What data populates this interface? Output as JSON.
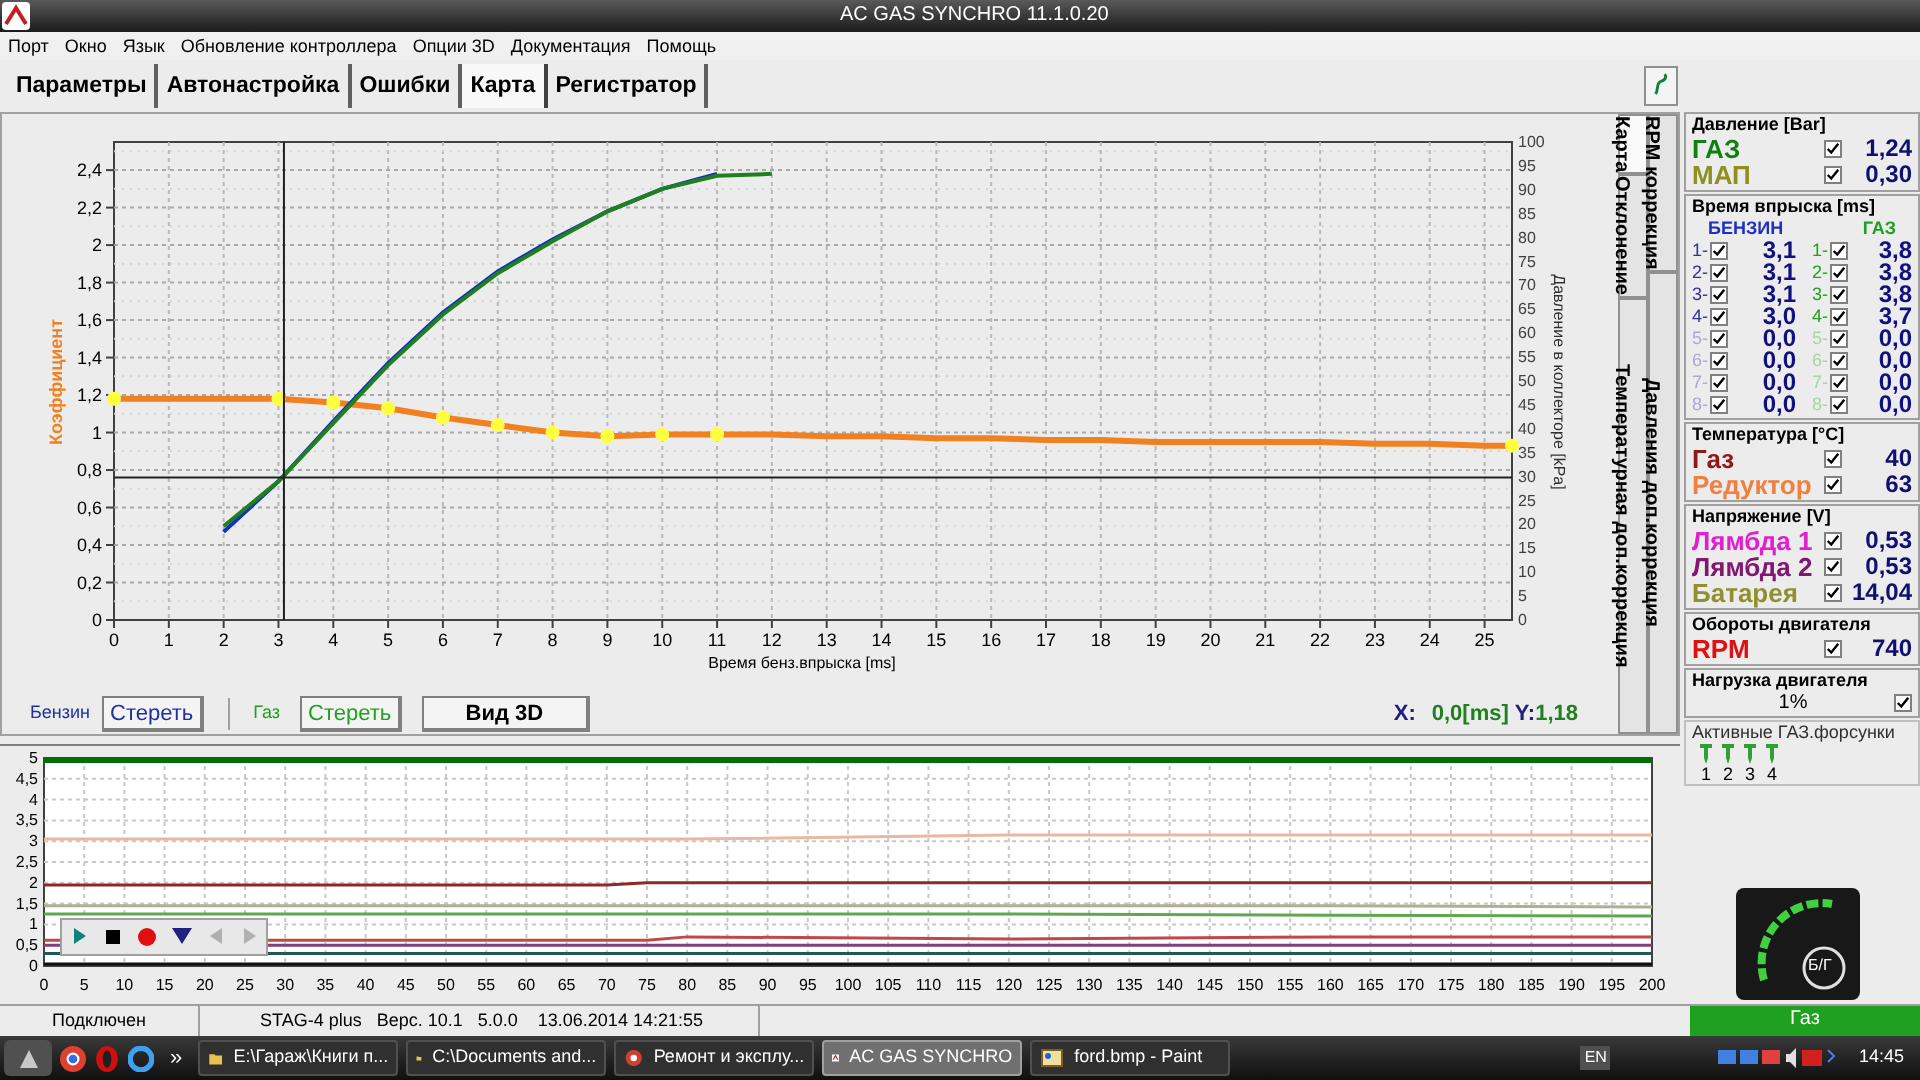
{
  "window": {
    "title": "AC GAS SYNCHRO  11.1.0.20"
  },
  "menu": [
    "Порт",
    "Окно",
    "Язык",
    "Обновление контроллера",
    "Опции 3D",
    "Документация",
    "Помощь"
  ],
  "tabs": [
    {
      "label": "Параметры",
      "selected": false
    },
    {
      "label": "Автонастройка",
      "selected": false
    },
    {
      "label": "Ошибки",
      "selected": false
    },
    {
      "label": "Карта",
      "selected": true
    },
    {
      "label": "Регистратор",
      "selected": false
    }
  ],
  "map_chart": {
    "right_axis": {
      "label": "Давление в коллекторе [kPa]",
      "ticks": [
        "100",
        "95",
        "90",
        "85",
        "80",
        "75",
        "70",
        "65",
        "60",
        "55",
        "50",
        "45",
        "40",
        "35",
        "30",
        "25",
        "20",
        "15",
        "10",
        "5",
        "0"
      ]
    },
    "chart_data": {
      "type": "line",
      "xlabel": "Время бенз.впрыска [ms]",
      "ylabel": "Коэффициент",
      "grid": true,
      "x": [
        0,
        1,
        2,
        3,
        4,
        5,
        6,
        7,
        8,
        9,
        10,
        11,
        12,
        13,
        14,
        15,
        16,
        17,
        18,
        19,
        20,
        21,
        22,
        23,
        24,
        25,
        25.5
      ],
      "series": [
        {
          "color": "#f08020",
          "values": [
            1.18,
            1.18,
            1.18,
            1.18,
            1.16,
            1.13,
            1.08,
            1.04,
            1.0,
            0.98,
            0.99,
            0.99,
            0.99,
            0.98,
            0.98,
            0.97,
            0.97,
            0.96,
            0.96,
            0.95,
            0.95,
            0.95,
            0.95,
            0.94,
            0.94,
            0.93,
            0.93
          ]
        },
        {
          "type": "scatter",
          "color": "#ffff40",
          "values": [
            1.18,
            null,
            null,
            1.18,
            1.16,
            1.13,
            1.08,
            1.04,
            1.0,
            0.98,
            0.99,
            0.99,
            null,
            null,
            null,
            null,
            null,
            null,
            null,
            null,
            null,
            null,
            null,
            null,
            null,
            null,
            0.93
          ]
        },
        {
          "color": "#1030c0",
          "values": [
            null,
            null,
            0.47,
            0.74,
            1.06,
            1.37,
            1.64,
            1.86,
            2.03,
            2.18,
            2.3,
            2.38,
            null,
            null,
            null,
            null,
            null,
            null,
            null,
            null,
            null,
            null,
            null,
            null,
            null,
            null,
            null
          ]
        },
        {
          "color": "#208020",
          "values": [
            null,
            null,
            0.5,
            0.74,
            1.05,
            1.36,
            1.63,
            1.85,
            2.02,
            2.18,
            2.3,
            2.37,
            2.38,
            null,
            null,
            null,
            null,
            null,
            null,
            null,
            null,
            null,
            null,
            null,
            null,
            null,
            null
          ]
        }
      ],
      "xlim": [
        0,
        25.5
      ],
      "ylim": [
        0,
        2.55
      ],
      "xticks": [
        0,
        1,
        2,
        3,
        4,
        5,
        6,
        7,
        8,
        9,
        10,
        11,
        12,
        13,
        14,
        15,
        16,
        17,
        18,
        19,
        20,
        21,
        22,
        23,
        24,
        25
      ],
      "yticks": [
        {
          "value": 0,
          "label": "0"
        },
        {
          "value": 0.2,
          "label": "0,2"
        },
        {
          "value": 0.4,
          "label": "0,4"
        },
        {
          "value": 0.6,
          "label": "0,6"
        },
        {
          "value": 0.8,
          "label": "0,8"
        },
        {
          "value": 1,
          "label": "1"
        },
        {
          "value": 1.2,
          "label": "1,2"
        },
        {
          "value": 1.4,
          "label": "1,4"
        },
        {
          "value": 1.6,
          "label": "1,6"
        },
        {
          "value": 1.8,
          "label": "1,8"
        },
        {
          "value": 2,
          "label": "2"
        },
        {
          "value": 2.2,
          "label": "2,2"
        },
        {
          "value": 2.4,
          "label": "2,4"
        }
      ],
      "ref_lines": [
        {
          "axis": "x",
          "value": 3.1
        },
        {
          "axis": "y",
          "value": 0.76
        }
      ]
    }
  },
  "side_tabs": [
    {
      "tabs": [
        {
          "label": "Карта",
          "selected": true
        },
        {
          "label": "Отклонение",
          "selected": false
        },
        {
          "label": "Температурная доп.коррекция",
          "selected": false
        }
      ]
    },
    {
      "tabs": [
        {
          "label": "RPM коррекция",
          "selected": false
        },
        {
          "label": "Давления доп.коррекция",
          "selected": false
        }
      ]
    }
  ],
  "controls": {
    "petrol_label": "Бензин",
    "petrol_button": "Стереть",
    "gas_label": "Газ",
    "gas_button": "Стереть",
    "view_button": "Вид 3D",
    "x_label": "X:",
    "x_value": "0,0[ms]",
    "y_label": "Y:",
    "y_value": "1,18"
  },
  "strip_chart": {
    "chart_data": {
      "type": "line",
      "grid": true,
      "x": [
        0,
        40,
        70,
        75,
        80,
        120,
        160,
        200
      ],
      "series": [
        {
          "color": "#007000",
          "values": [
            4.95,
            4.95,
            4.95,
            4.95,
            4.95,
            4.95,
            4.95,
            4.95
          ]
        },
        {
          "color": "#e8b8a0",
          "values": [
            3.05,
            3.05,
            3.05,
            3.05,
            3.05,
            3.15,
            3.15,
            3.15
          ]
        },
        {
          "color": "#902828",
          "values": [
            1.95,
            1.95,
            1.95,
            2.0,
            2.0,
            2.0,
            2.0,
            2.0
          ]
        },
        {
          "color": "#b0b090",
          "values": [
            1.45,
            1.45,
            1.45,
            1.45,
            1.45,
            1.45,
            1.45,
            1.42
          ]
        },
        {
          "color": "#60a850",
          "values": [
            1.25,
            1.25,
            1.25,
            1.25,
            1.25,
            1.25,
            1.22,
            1.2
          ]
        },
        {
          "color": "#c04848",
          "values": [
            0.62,
            0.62,
            0.62,
            0.62,
            0.7,
            0.65,
            0.7,
            0.7
          ]
        },
        {
          "color": "#804080",
          "values": [
            0.5,
            0.5,
            0.5,
            0.5,
            0.5,
            0.5,
            0.5,
            0.5
          ]
        },
        {
          "color": "#205858",
          "values": [
            0.3,
            0.3,
            0.3,
            0.3,
            0.3,
            0.3,
            0.3,
            0.3
          ]
        },
        {
          "color": "#101010",
          "values": [
            0.05,
            0.05,
            0.05,
            0.05,
            0.05,
            0.05,
            0.05,
            0.05
          ]
        }
      ],
      "xlim": [
        0,
        200
      ],
      "ylim": [
        0,
        5
      ],
      "xticks": [
        0,
        5,
        10,
        15,
        20,
        25,
        30,
        35,
        40,
        45,
        50,
        55,
        60,
        65,
        70,
        75,
        80,
        85,
        90,
        95,
        100,
        105,
        110,
        115,
        120,
        125,
        130,
        135,
        140,
        145,
        150,
        155,
        160,
        165,
        170,
        175,
        180,
        185,
        190,
        195,
        200
      ],
      "yticks": [
        {
          "value": 0,
          "label": "0"
        },
        {
          "value": 0.5,
          "label": "0,5"
        },
        {
          "value": 1,
          "label": "1"
        },
        {
          "value": 1.5,
          "label": "1,5"
        },
        {
          "value": 2,
          "label": "2"
        },
        {
          "value": 2.5,
          "label": "2,5"
        },
        {
          "value": 3,
          "label": "3"
        },
        {
          "value": 3.5,
          "label": "3,5"
        },
        {
          "value": 4,
          "label": "4"
        },
        {
          "value": 4.5,
          "label": "4,5"
        },
        {
          "value": 5,
          "label": "5"
        }
      ]
    }
  },
  "right_panel": {
    "pressure": {
      "title": "Давление [Bar]",
      "items": [
        {
          "label": "ГАЗ",
          "color": "#108010",
          "checked": true,
          "value": "1,24"
        },
        {
          "label": "МАП",
          "color": "#909020",
          "checked": true,
          "value": "0,30"
        }
      ]
    },
    "injection": {
      "title": "Время впрыска [ms]",
      "petrol_header": "БЕНЗИН",
      "gas_header": "ГАЗ",
      "rows": [
        {
          "petrol_index": "1-",
          "petrol_checked": true,
          "petrol_value": "3,1",
          "gas_index": "1-",
          "gas_checked": true,
          "gas_value": "3,8",
          "active": true
        },
        {
          "petrol_index": "2-",
          "petrol_checked": true,
          "petrol_value": "3,1",
          "gas_index": "2-",
          "gas_checked": true,
          "gas_value": "3,8",
          "active": true
        },
        {
          "petrol_index": "3-",
          "petrol_checked": true,
          "petrol_value": "3,1",
          "gas_index": "3-",
          "gas_checked": true,
          "gas_value": "3,8",
          "active": true
        },
        {
          "petrol_index": "4-",
          "petrol_checked": true,
          "petrol_value": "3,0",
          "gas_index": "4-",
          "gas_checked": true,
          "gas_value": "3,7",
          "active": true
        },
        {
          "petrol_index": "5-",
          "petrol_checked": true,
          "petrol_value": "0,0",
          "gas_index": "5-",
          "gas_checked": true,
          "gas_value": "0,0",
          "active": false
        },
        {
          "petrol_index": "6-",
          "petrol_checked": true,
          "petrol_value": "0,0",
          "gas_index": "6-",
          "gas_checked": true,
          "gas_value": "0,0",
          "active": false
        },
        {
          "petrol_index": "7-",
          "petrol_checked": true,
          "petrol_value": "0,0",
          "gas_index": "7-",
          "gas_checked": true,
          "gas_value": "0,0",
          "active": false
        },
        {
          "petrol_index": "8-",
          "petrol_checked": true,
          "petrol_value": "0,0",
          "gas_index": "8-",
          "gas_checked": true,
          "gas_value": "0,0",
          "active": false
        }
      ]
    },
    "temperature": {
      "title": "Температура  [°C]",
      "items": [
        {
          "label": "Газ",
          "color": "#901818",
          "checked": true,
          "value": "40"
        },
        {
          "label": "Редуктор",
          "color": "#f08040",
          "checked": true,
          "value": "63"
        }
      ]
    },
    "voltage": {
      "title": "Напряжение [V]",
      "items": [
        {
          "label": "Лямбда 1",
          "color": "#e020d0",
          "checked": true,
          "value": "0,53"
        },
        {
          "label": "Лямбда 2",
          "color": "#801870",
          "checked": true,
          "value": "0,53"
        },
        {
          "label": "Батарея",
          "color": "#909030",
          "checked": true,
          "value": "14,04"
        }
      ]
    },
    "rpm": {
      "title": "Обороты двигателя",
      "items": [
        {
          "label": "RPM",
          "color": "#e01010",
          "checked": true,
          "value": "740"
        }
      ]
    },
    "load": {
      "title": "Нагрузка двигателя",
      "value": "1%",
      "checked": true
    },
    "injectors": {
      "title": "Активные ГАЗ.форсунки",
      "items": [
        {
          "label": "1",
          "active": true
        },
        {
          "label": "2",
          "active": true
        },
        {
          "label": "3",
          "active": true
        },
        {
          "label": "4",
          "active": true
        }
      ]
    }
  },
  "gauge": {
    "label": "Б/Г"
  },
  "status_bar": {
    "connection": "Подключен",
    "info": "STAG-4 plus   Верс. 10.1   5.0.0    13.06.2014 14:21:55",
    "fuel": "Газ"
  },
  "taskbar": {
    "more": "»",
    "tasks": [
      {
        "label": "E:\\Гараж\\Книги п...",
        "selected": false
      },
      {
        "label": "C:\\Documents and...",
        "selected": false
      },
      {
        "label": "Ремонт и эксплу...",
        "selected": false
      },
      {
        "label": "AC GAS SYNCHRO",
        "selected": true
      },
      {
        "label": "ford.bmp - Paint",
        "selected": false
      }
    ],
    "language": "EN",
    "clock": "14:45"
  }
}
